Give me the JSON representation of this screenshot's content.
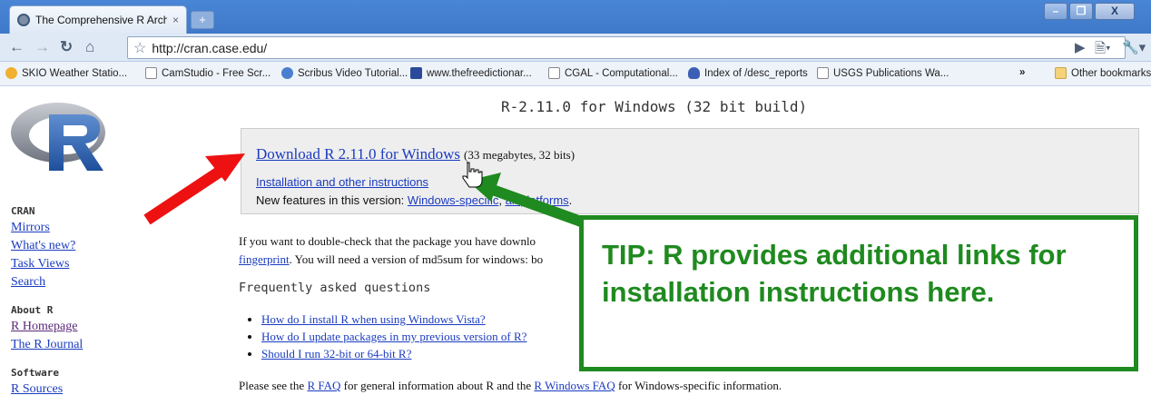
{
  "browser": {
    "tab_title": "The Comprehensive R Arch...",
    "tab_close": "×",
    "new_tab": "+",
    "url": "http://cran.case.edu/",
    "window_controls": [
      "–",
      "❐",
      "X"
    ],
    "bookmarks": [
      {
        "label": "SKIO Weather Statio...",
        "icon": "weather-icon",
        "color": "#f0b030"
      },
      {
        "label": "CamStudio - Free Scr...",
        "icon": "page-icon",
        "color": "#ffffff"
      },
      {
        "label": "Scribus Video Tutorial...",
        "icon": "scribus-icon",
        "color": "#4a7fd0"
      },
      {
        "label": "www.thefreedictionar...",
        "icon": "dictionary-icon",
        "color": "#2b4a9a"
      },
      {
        "label": "CGAL - Computational...",
        "icon": "page-icon",
        "color": "#ffffff"
      },
      {
        "label": "Index of /desc_reports",
        "icon": "shield-icon",
        "color": "#3b5fb5"
      },
      {
        "label": "USGS Publications Wa...",
        "icon": "page-icon",
        "color": "#ffffff"
      }
    ],
    "overflow": "»",
    "other_bookmarks": "Other bookmarks"
  },
  "page": {
    "heading": "R-2.11.0 for Windows (32 bit build)",
    "download": {
      "link": "Download R 2.11.0 for Windows",
      "size": "(33 megabytes, 32 bits)",
      "instructions": "Installation and other instructions",
      "features_prefix": "New features in this version:",
      "features_link1": "Windows-specific",
      "features_sep": ", ",
      "features_link2": "all platforms",
      "features_end": "."
    },
    "para_line1": "If you want to double-check that the package you have downlo",
    "para_line2_link": "fingerprint",
    "para_line2_text": ". You will need a version of md5sum for windows: bo",
    "para_right_link": "true",
    "faq_heading": "Frequently asked questions",
    "faq": [
      "How do I install R when using Windows Vista?",
      "How do I update packages in my previous version of R?",
      "Should I run 32-bit or 64-bit R?"
    ],
    "footer": {
      "text1": "Please see the ",
      "link1": "R FAQ",
      "text2": " for general information about R and the ",
      "link2": "R Windows FAQ",
      "text3": " for Windows-specific information."
    }
  },
  "sidebar": {
    "cran_heading": "CRAN",
    "cran_links": [
      "Mirrors",
      "What's new?",
      "Task Views",
      "Search"
    ],
    "about_heading": "About R",
    "about_links": [
      "R Homepage",
      "The R Journal"
    ],
    "software_heading": "Software",
    "software_links": [
      "R Sources"
    ]
  },
  "annotation": {
    "tip": "TIP: R provides additional links for installation instructions here.",
    "red_arrow_color": "#ee1111",
    "green_arrow_color": "#1f8a1f"
  }
}
